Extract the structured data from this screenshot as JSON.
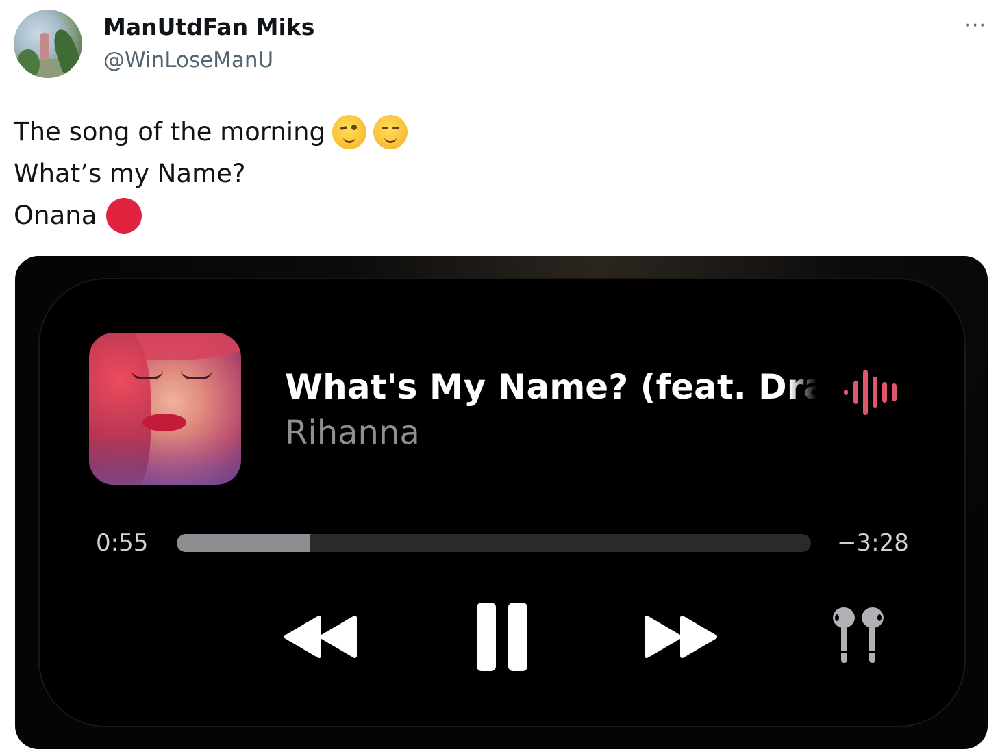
{
  "tweet": {
    "author_name": "ManUtdFan Miks",
    "author_handle": "@WinLoseManU",
    "more_label": "···",
    "lines": [
      "The song of the morning",
      "What’s my Name?",
      "Onana"
    ],
    "line_emojis": [
      [
        "winking-face-emoji",
        "relieved-face-emoji"
      ],
      [],
      [
        "red-circle-emoji"
      ]
    ]
  },
  "player": {
    "song_title": "What's My Name? (feat. Drake)",
    "artist": "Rihanna",
    "elapsed": "0:55",
    "remaining": "−3:28",
    "progress_fraction": 0.21,
    "accent_color": "#e0566f",
    "icons": [
      "rewind-icon",
      "pause-icon",
      "fast-forward-icon",
      "airpods-icon",
      "audio-waveform-icon"
    ]
  }
}
